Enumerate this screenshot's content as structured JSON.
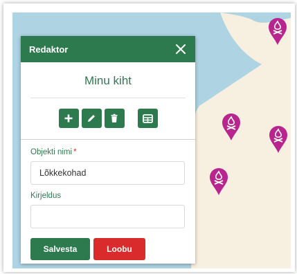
{
  "colors": {
    "header": "#2e7a4f",
    "accent": "#2e7a4f",
    "danger": "#d92b2b",
    "water": "#aed3e3",
    "land": "#f7efdf",
    "marker": "#b9258f"
  },
  "editor": {
    "title": "Redaktor",
    "close_icon": "close-icon",
    "layer_name": "Minu kiht",
    "toolbar": {
      "add_icon": "plus-icon",
      "edit_icon": "pencil-icon",
      "delete_icon": "trash-icon",
      "table_icon": "table-icon"
    },
    "fields": {
      "name_label": "Objekti nimi",
      "required_mark": "*",
      "name_value": "Lõkkekohad",
      "description_label": "Kirjeldus",
      "description_value": ""
    },
    "buttons": {
      "save": "Salvesta",
      "cancel": "Loobu"
    }
  },
  "map": {
    "marker_icon": "campfire-marker-icon",
    "marker_count": 4
  }
}
